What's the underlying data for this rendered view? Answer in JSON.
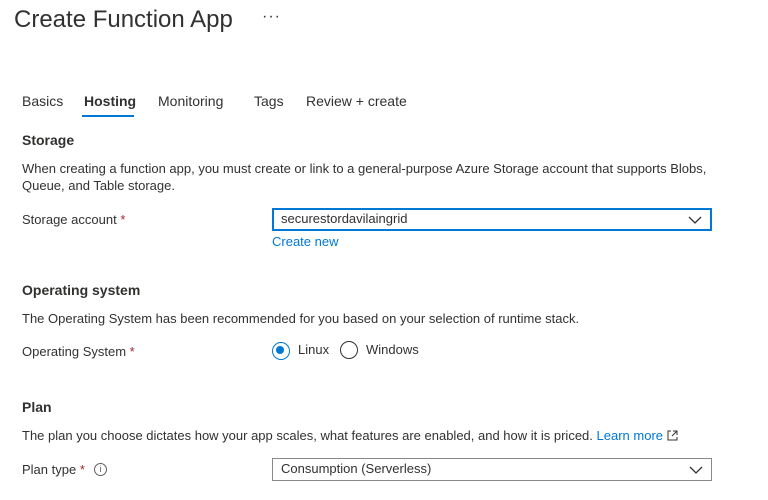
{
  "header": {
    "title": "Create Function App",
    "more_label": "···"
  },
  "tabs": [
    {
      "label": "Basics",
      "active": false
    },
    {
      "label": "Hosting",
      "active": true
    },
    {
      "label": "Monitoring",
      "active": false
    },
    {
      "label": "Tags",
      "active": false
    },
    {
      "label": "Review + create",
      "active": false
    }
  ],
  "storage": {
    "heading": "Storage",
    "description": "When creating a function app, you must create or link to a general-purpose Azure Storage account that supports Blobs, Queue, and Table storage.",
    "account_label": "Storage account",
    "required_mark": "*",
    "account_value": "securestordavilaingrid",
    "create_new": "Create new"
  },
  "os": {
    "heading": "Operating system",
    "description": "The Operating System has been recommended for you based on your selection of runtime stack.",
    "label": "Operating System",
    "required_mark": "*",
    "options": [
      {
        "label": "Linux",
        "selected": true
      },
      {
        "label": "Windows",
        "selected": false
      }
    ]
  },
  "plan": {
    "heading": "Plan",
    "description": "The plan you choose dictates how your app scales, what features are enabled, and how it is priced.",
    "learn_more": "Learn more",
    "type_label": "Plan type",
    "required_mark": "*",
    "info_icon": "i",
    "type_value": "Consumption (Serverless)"
  },
  "colors": {
    "accent": "#0078d4",
    "required": "#a4262c",
    "text": "#323130"
  },
  "icons": [
    "more-icon",
    "chevron-down-icon",
    "external-link-icon",
    "info-icon",
    "radio-icon"
  ]
}
